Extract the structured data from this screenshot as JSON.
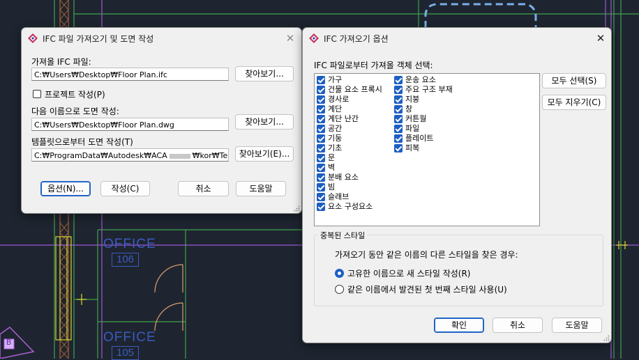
{
  "background": {
    "rooms": [
      {
        "label": "OFFICE",
        "number": "106"
      },
      {
        "label": "OFFICE",
        "number": "105"
      }
    ],
    "tag": "B"
  },
  "dialog1": {
    "title": "IFC 파일 가져오기 및 도면 작성",
    "ifc_label": "가져올 IFC 파일:",
    "ifc_path": "C:₩Users₩Desktop₩Floor Plan.ifc",
    "browse1": "찾아보기...",
    "project_checkbox": "프로젝트 작성(P)",
    "project_checked": false,
    "dwg_label": "다음 이름으로 도면 작성:",
    "dwg_path": "C:₩Users₩Desktop₩Floor Plan.dwg",
    "browse2": "찾아보기...",
    "template_label": "템플릿으로부터 도면 작성(T)",
    "template_path_a": "C:₩ProgramData₩Autodesk₩ACA",
    "template_path_b": "₩kor₩Template",
    "browse3": "찾아보기(E)...",
    "buttons": {
      "options": "옵션(N)...",
      "create": "작성(C)",
      "cancel": "취소",
      "help": "도움말"
    }
  },
  "dialog2": {
    "title": "IFC 가져오기 옵션",
    "select_label": "IFC 파일로부터 가져올 객체 선택:",
    "objects_col1": [
      "가구",
      "건물 요소 프록시",
      "경사로",
      "계단",
      "계단 난간",
      "공간",
      "기둥",
      "기초",
      "문",
      "벽",
      "분배 요소",
      "빔",
      "슬래브",
      "요소 구성요소"
    ],
    "objects_col2": [
      "운송 요소",
      "주요 구조 부재",
      "지붕",
      "창",
      "커튼월",
      "파일",
      "플레이트",
      "피복"
    ],
    "select_all": "모두 선택(S)",
    "clear_all": "모두 지우기(C)",
    "dup_group_title": "중복된 스타일",
    "dup_question": "가져오기 동안 같은 이름의 다른 스타일을 찾은 경우:",
    "radio1": "고유한 이름으로 새 스타일 작성(R)",
    "radio2": "같은 이름에서 발견된 첫 번째 스타일 사용(U)",
    "radio_selected": 0,
    "buttons": {
      "ok": "확인",
      "cancel": "취소",
      "help": "도움말"
    }
  },
  "colors": {
    "accent": "#1c5fc4",
    "cad_bg": "#1e2530",
    "dialog_bg": "#f0f0f0"
  }
}
